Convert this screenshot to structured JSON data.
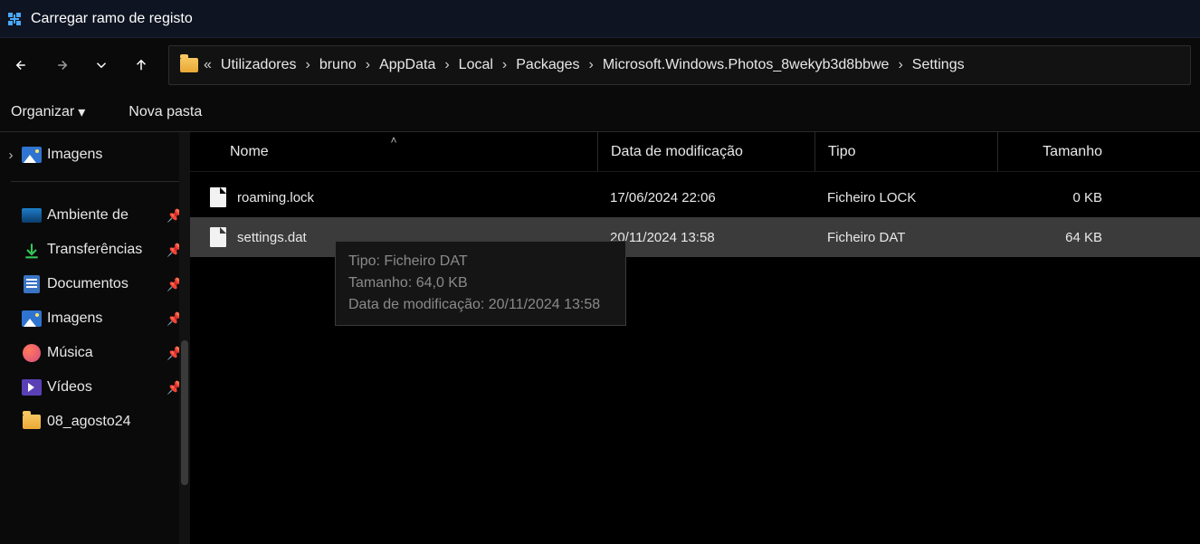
{
  "title": "Carregar ramo de registo",
  "breadcrumbs": [
    "Utilizadores",
    "bruno",
    "AppData",
    "Local",
    "Packages",
    "Microsoft.Windows.Photos_8wekyb3d8bbwe",
    "Settings"
  ],
  "toolbar": {
    "organize": "Organizar",
    "new_folder": "Nova pasta"
  },
  "sidebar": {
    "top": "Imagens",
    "items": [
      {
        "label": "Ambiente de ",
        "pinned": true,
        "icon": "desktop"
      },
      {
        "label": "Transferências",
        "pinned": true,
        "icon": "download"
      },
      {
        "label": "Documentos",
        "pinned": true,
        "icon": "doc"
      },
      {
        "label": "Imagens",
        "pinned": true,
        "icon": "pict"
      },
      {
        "label": "Música",
        "pinned": true,
        "icon": "music"
      },
      {
        "label": "Vídeos",
        "pinned": true,
        "icon": "video"
      },
      {
        "label": "08_agosto24",
        "pinned": false,
        "icon": "folder"
      }
    ]
  },
  "columns": {
    "name": "Nome",
    "date": "Data de modificação",
    "type": "Tipo",
    "size": "Tamanho"
  },
  "files": [
    {
      "name": "roaming.lock",
      "date": "17/06/2024 22:06",
      "type": "Ficheiro LOCK",
      "size": "0 KB",
      "selected": false
    },
    {
      "name": "settings.dat",
      "date": "20/11/2024 13:58",
      "type": "Ficheiro DAT",
      "size": "64 KB",
      "selected": true
    }
  ],
  "tooltip": {
    "line1": "Tipo: Ficheiro DAT",
    "line2": "Tamanho: 64,0 KB",
    "line3": "Data de modificação: 20/11/2024 13:58"
  }
}
